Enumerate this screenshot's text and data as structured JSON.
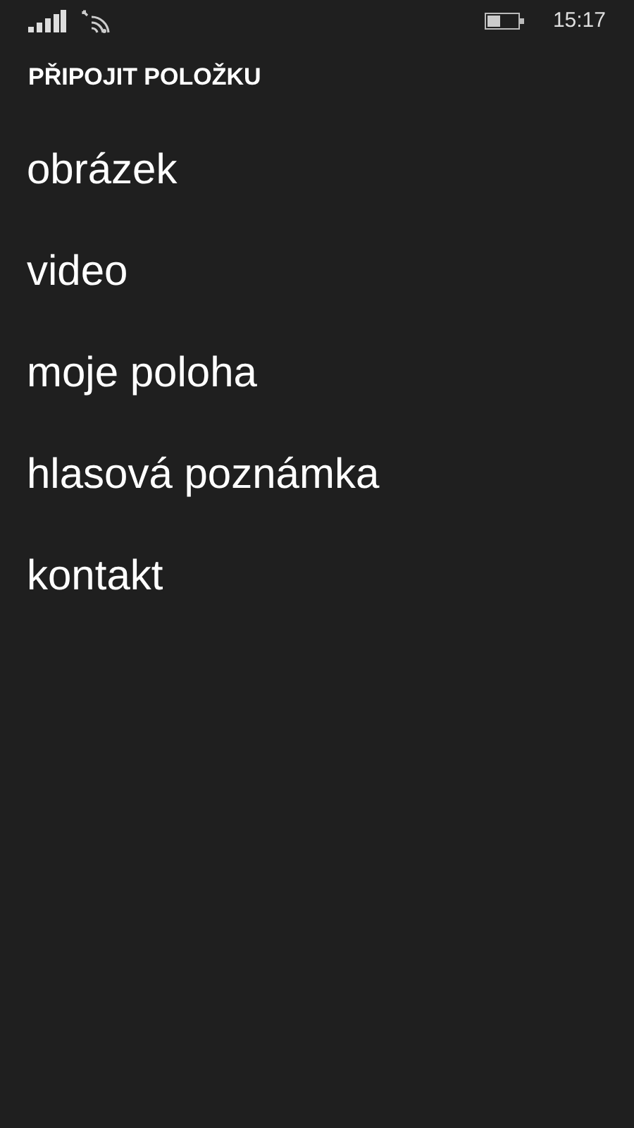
{
  "status_bar": {
    "time": "15:17"
  },
  "title": "PŘIPOJIT POLOŽKU",
  "items": [
    {
      "label": "obrázek"
    },
    {
      "label": "video"
    },
    {
      "label": "moje poloha"
    },
    {
      "label": "hlasová poznámka"
    },
    {
      "label": "kontakt"
    }
  ]
}
